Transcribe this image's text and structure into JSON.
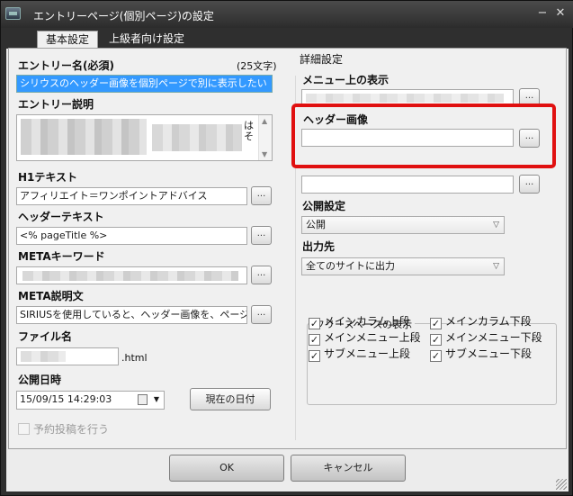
{
  "window": {
    "title": "エントリーページ(個別ページ)の設定",
    "minimize": "−",
    "close": "✕"
  },
  "tabs": [
    {
      "label": "基本設定",
      "active": true
    },
    {
      "label": "上級者向け設定",
      "active": false
    }
  ],
  "left": {
    "entry_name_label": "エントリー名(必須)",
    "entry_name_count": "(25文字)",
    "entry_name_value": "シリウスのヘッダー画像を個別ページで別に表示したい",
    "entry_desc_label": "エントリー説明",
    "entry_desc_visible_fragment": "はそ",
    "h1_label": "H1テキスト",
    "h1_value": "アフィリエイト＝ワンポイントアドバイス",
    "header_text_label": "ヘッダーテキスト",
    "header_text_value": "<% pageTitle %>",
    "meta_keywords_label": "METAキーワード",
    "meta_desc_label": "META説明文",
    "meta_desc_value": "SIRIUSを使用していると、ヘッダー画像を、ページ細",
    "filename_label": "ファイル名",
    "filename_ext": ".html",
    "pubdate_label": "公開日時",
    "pubdate_value": "15/09/15 14:29:03",
    "today_button": "現在の日付",
    "schedule_label": "予約投稿を行う"
  },
  "right": {
    "section_title": "詳細設定",
    "menu_display_label": "メニュー上の表示",
    "header_image_label": "ヘッダー画像",
    "header_image_value": "",
    "publish_label": "公開設定",
    "publish_value": "公開",
    "output_label": "出力先",
    "output_value": "全てのサイトに出力",
    "freespace_title": "フリースペースの表示",
    "freespace_items": [
      {
        "label": "メインカラム上段",
        "checked": true
      },
      {
        "label": "メインカラム下段",
        "checked": true
      },
      {
        "label": "メインメニュー上段",
        "checked": true
      },
      {
        "label": "メインメニュー下段",
        "checked": true
      },
      {
        "label": "サブメニュー上段",
        "checked": true
      },
      {
        "label": "サブメニュー下段",
        "checked": true
      }
    ]
  },
  "footer": {
    "ok": "OK",
    "cancel": "キャンセル"
  },
  "common": {
    "dots": "...",
    "check_mark": "✓",
    "chevron": "▽"
  },
  "colors": {
    "highlight_border": "#e01010",
    "selection": "#3399ff"
  }
}
